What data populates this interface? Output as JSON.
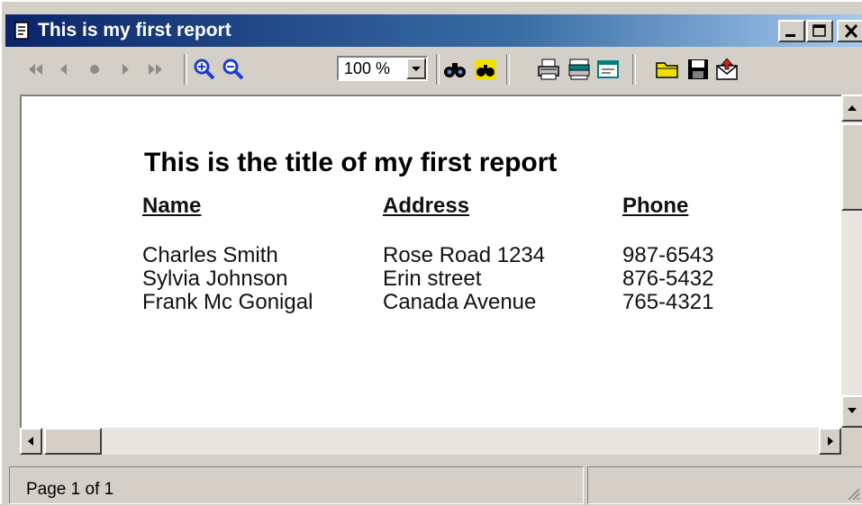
{
  "window": {
    "title": "This is my first report",
    "title_icon": "report-document-icon",
    "controls": [
      "minimize-icon",
      "maximize-icon",
      "close-icon"
    ]
  },
  "toolbar": {
    "buttons": [
      {
        "name": "first-page-icon"
      },
      {
        "name": "previous-page-icon"
      },
      {
        "name": "stop-icon"
      },
      {
        "name": "next-page-icon"
      },
      {
        "name": "last-page-icon"
      },
      {
        "name": "zoom-in-icon"
      },
      {
        "name": "zoom-out-icon"
      },
      {
        "name": "find-icon"
      },
      {
        "name": "find-next-icon"
      },
      {
        "name": "print-icon"
      },
      {
        "name": "print-setup-icon"
      },
      {
        "name": "page-setup-icon"
      },
      {
        "name": "open-folder-icon"
      },
      {
        "name": "save-icon"
      },
      {
        "name": "export-email-icon"
      }
    ],
    "zoom_value": "100 %"
  },
  "report": {
    "title": "This is the title of my first report",
    "columns": [
      "Name",
      "Address",
      "Phone"
    ],
    "rows": [
      [
        "Charles Smith",
        "Rose Road 1234",
        "987-6543"
      ],
      [
        "Sylvia Johnson",
        "Erin street",
        "876-5432"
      ],
      [
        "Frank Mc Gonigal",
        "Canada Avenue",
        "765-4321"
      ]
    ]
  },
  "status": {
    "page_text": "Page 1 of 1",
    "second_panel": ""
  },
  "colors": {
    "titlebar_start": "#0a246a",
    "titlebar_end": "#a6caf0",
    "chrome": "#d4d0c8",
    "nav_disabled": "#8c8c8c",
    "zoom_blue": "#1c3cd6",
    "folder_yellow": "#f0e000"
  }
}
